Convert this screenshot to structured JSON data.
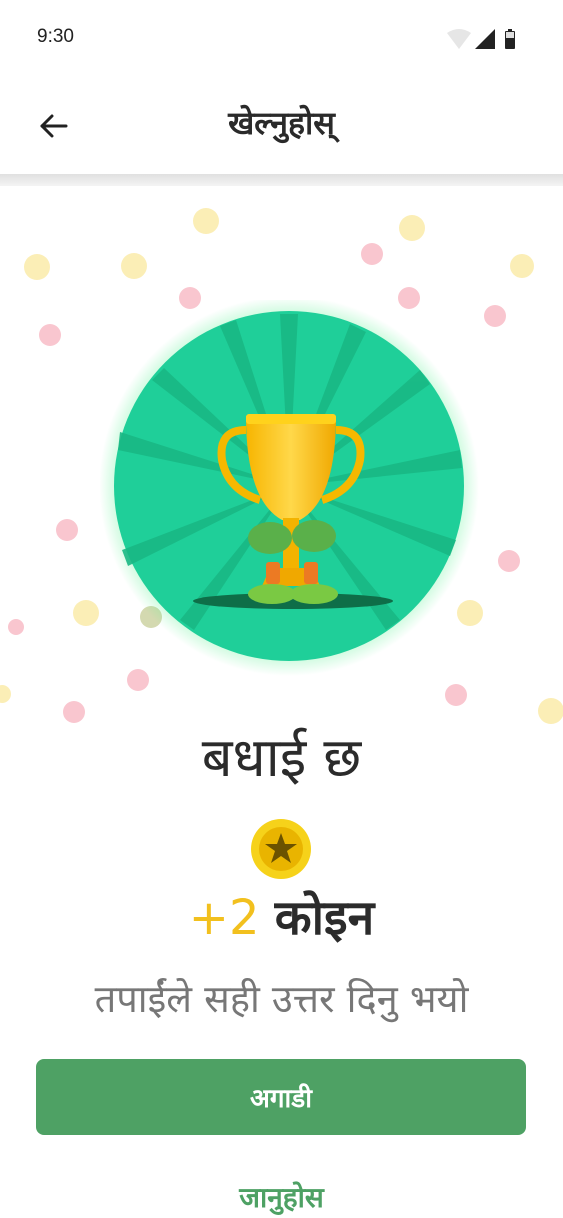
{
  "status_bar": {
    "time": "9:30",
    "icons": [
      "wifi-icon",
      "signal-icon",
      "battery-icon"
    ]
  },
  "header": {
    "back_icon": "arrow-left-icon",
    "title": "खेल्नुहोस्"
  },
  "hero": {
    "icon": "trophy-icon",
    "circle_color": "#1fcf99"
  },
  "result": {
    "headline": "बधाई छ",
    "coin_icon": "star-coin-icon",
    "reward_amount": "+2",
    "reward_unit": "कोइन",
    "message": "तपाईंले सही उत्तर दिनु भयो"
  },
  "actions": {
    "next_label": "अगाडी",
    "learn_label": "जानुहोस"
  },
  "colors": {
    "accent_green": "#4ea164",
    "coin_gold": "#f2c01e",
    "confetti_pink": "#f9c6cf",
    "confetti_yellow": "#fbeeb6"
  }
}
